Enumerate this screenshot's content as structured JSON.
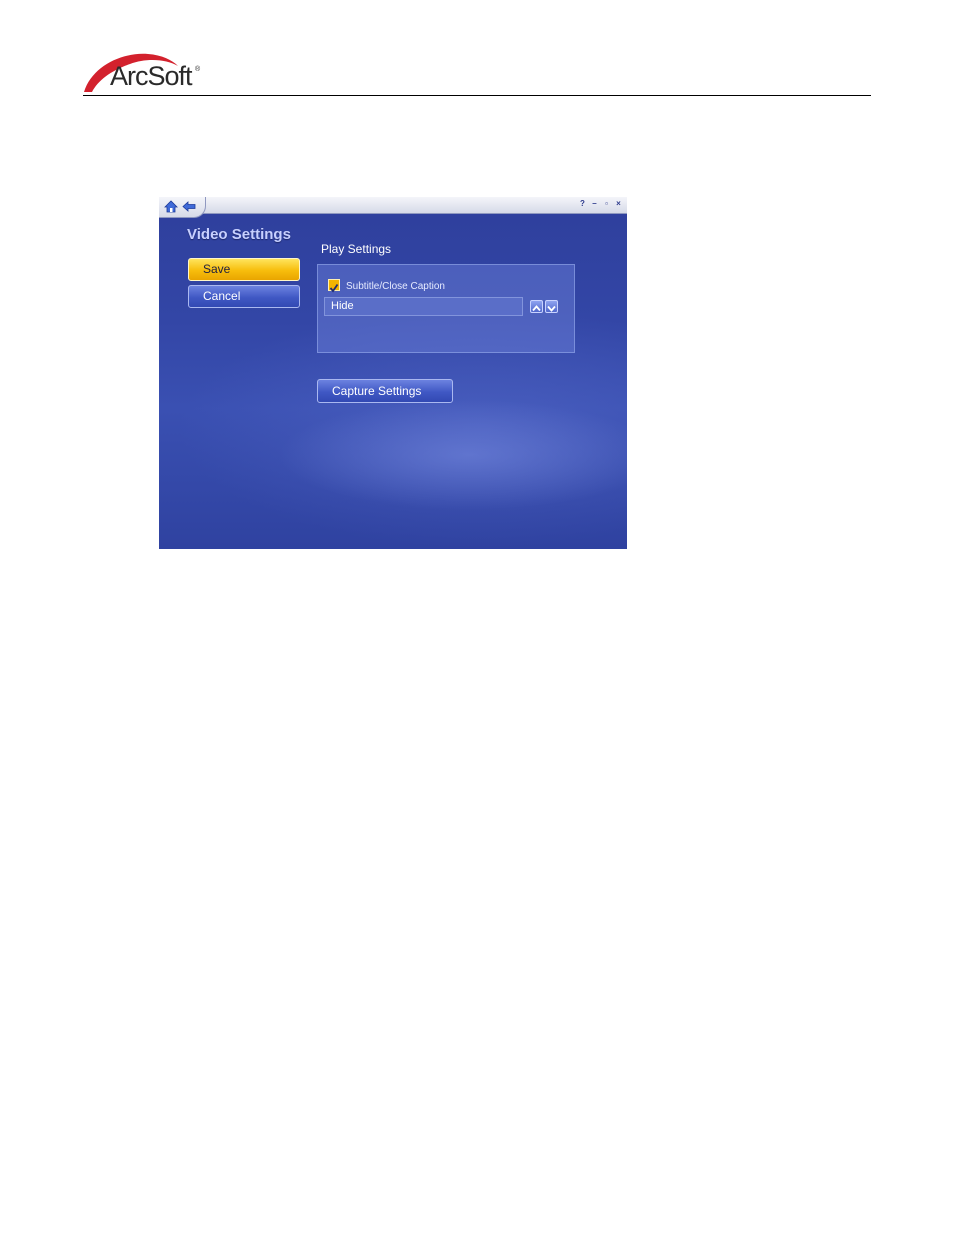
{
  "header": {
    "logo_text": "ArcSoft",
    "logo_reg": "®"
  },
  "app": {
    "page_title": "Video Settings",
    "buttons": {
      "save_label": "Save",
      "cancel_label": "Cancel",
      "capture_label": "Capture Settings"
    },
    "play_settings": {
      "section_title": "Play Settings",
      "subtitle_checkbox_label": "Subtitle/Close Caption",
      "subtitle_checked": true,
      "subtitle_value": "Hide"
    },
    "window_controls": {
      "help": "?",
      "minimize": "–",
      "restore": "▫",
      "close": "×"
    }
  },
  "colors": {
    "accent_yellow": "#f7bd0c",
    "background_blue": "#3346a6",
    "title_text": "#c7d0ff"
  }
}
